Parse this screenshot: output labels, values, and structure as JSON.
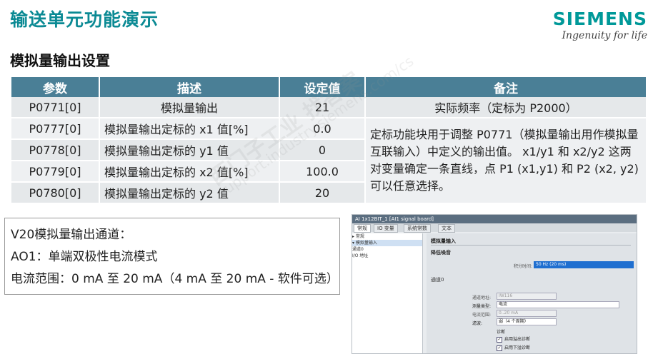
{
  "title": "输送单元功能演示",
  "logo": {
    "brand": "SIEMENS",
    "tagline": "Ingenuity for life"
  },
  "subtitle": "模拟量输出设置",
  "table": {
    "headers": [
      "参数",
      "描述",
      "设定值",
      "备注"
    ],
    "rows": [
      {
        "param": "P0771[0]",
        "desc": "模拟量输出",
        "value": "21"
      },
      {
        "param": "P0777[0]",
        "desc": "模拟量输出定标的 x1 值[%]",
        "value": "0.0"
      },
      {
        "param": "P0778[0]",
        "desc": "模拟量输出定标的 y1 值",
        "value": "0"
      },
      {
        "param": "P0779[0]",
        "desc": "模拟量输出定标的 x2 值[%]",
        "value": "100.0"
      },
      {
        "param": "P0780[0]",
        "desc": "模拟量输出定标的 y2 值",
        "value": "20"
      }
    ],
    "note_first": "实际频率（定标为 P2000）",
    "note_rest": "定标功能块用于调整 P0771（模拟量输出用作模拟量互联输入）中定义的输出值。 x1/y1 和 x2/y2 这两对变量确定一条直线，点 P1 (x1,y1) 和 P2 (x2, y2)可以任意选择。"
  },
  "infobox": {
    "line1": "V20模拟量输出通道：",
    "line2": "AO1：单端双极性电流模式",
    "line3": "电流范围：0 mA 至 20 mA（4 mA 至 20 mA - 软件可选）"
  },
  "screenshot": {
    "window_title": "AI 1x12BIT_1 [AI1 signal board]",
    "tabs": [
      "常规",
      "IO 变量",
      "系统常数",
      "文本"
    ],
    "tree": [
      "▸ 常规",
      "▾ 模拟量输入",
      "    通道0",
      "    I/O 地址"
    ],
    "section_main": "模拟量输入",
    "section_noise": "降低噪音",
    "integration_label": "积分时间:",
    "integration_value": "50 Hz (20 ms)",
    "channel_label": "通道0",
    "channel_addr_label": "通道地址:",
    "channel_addr_value": "IW116",
    "meas_type_label": "测量类型:",
    "meas_type_value": "电流",
    "range_label": "电流范围:",
    "range_value": "0..20 mA",
    "smoothing_label": "滤波:",
    "smoothing_value": "弱（4 个周期）",
    "diag_label": "诊断",
    "check1": "启用溢出诊断",
    "check2": "启用下溢诊断"
  },
  "watermark": {
    "line1": "西门子工业 找答案",
    "line2": "support.industry.siemens.com/cs"
  }
}
